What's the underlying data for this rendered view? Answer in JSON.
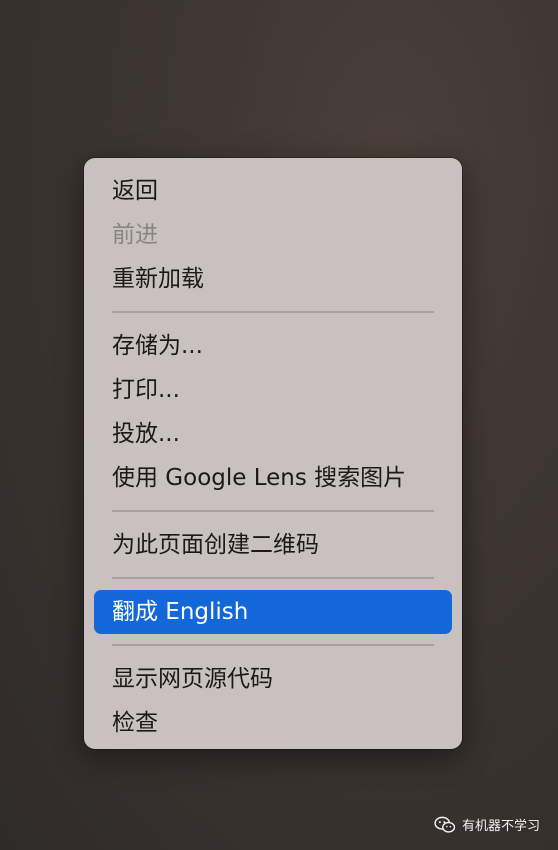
{
  "menu": {
    "items": [
      {
        "label": "返回"
      },
      {
        "label": "前进"
      },
      {
        "label": "重新加载"
      },
      {
        "label": "存储为..."
      },
      {
        "label": "打印..."
      },
      {
        "label": "投放..."
      },
      {
        "label": "使用 Google Lens 搜索图片"
      },
      {
        "label": "为此页面创建二维码"
      },
      {
        "label": "翻成 English"
      },
      {
        "label": "显示网页源代码"
      },
      {
        "label": "检查"
      }
    ]
  },
  "watermark": {
    "text": "有机器不学习",
    "icon": "wechat-icon"
  },
  "colors": {
    "highlight": "#1467d9",
    "menu_bg": "#c9c0c0"
  }
}
